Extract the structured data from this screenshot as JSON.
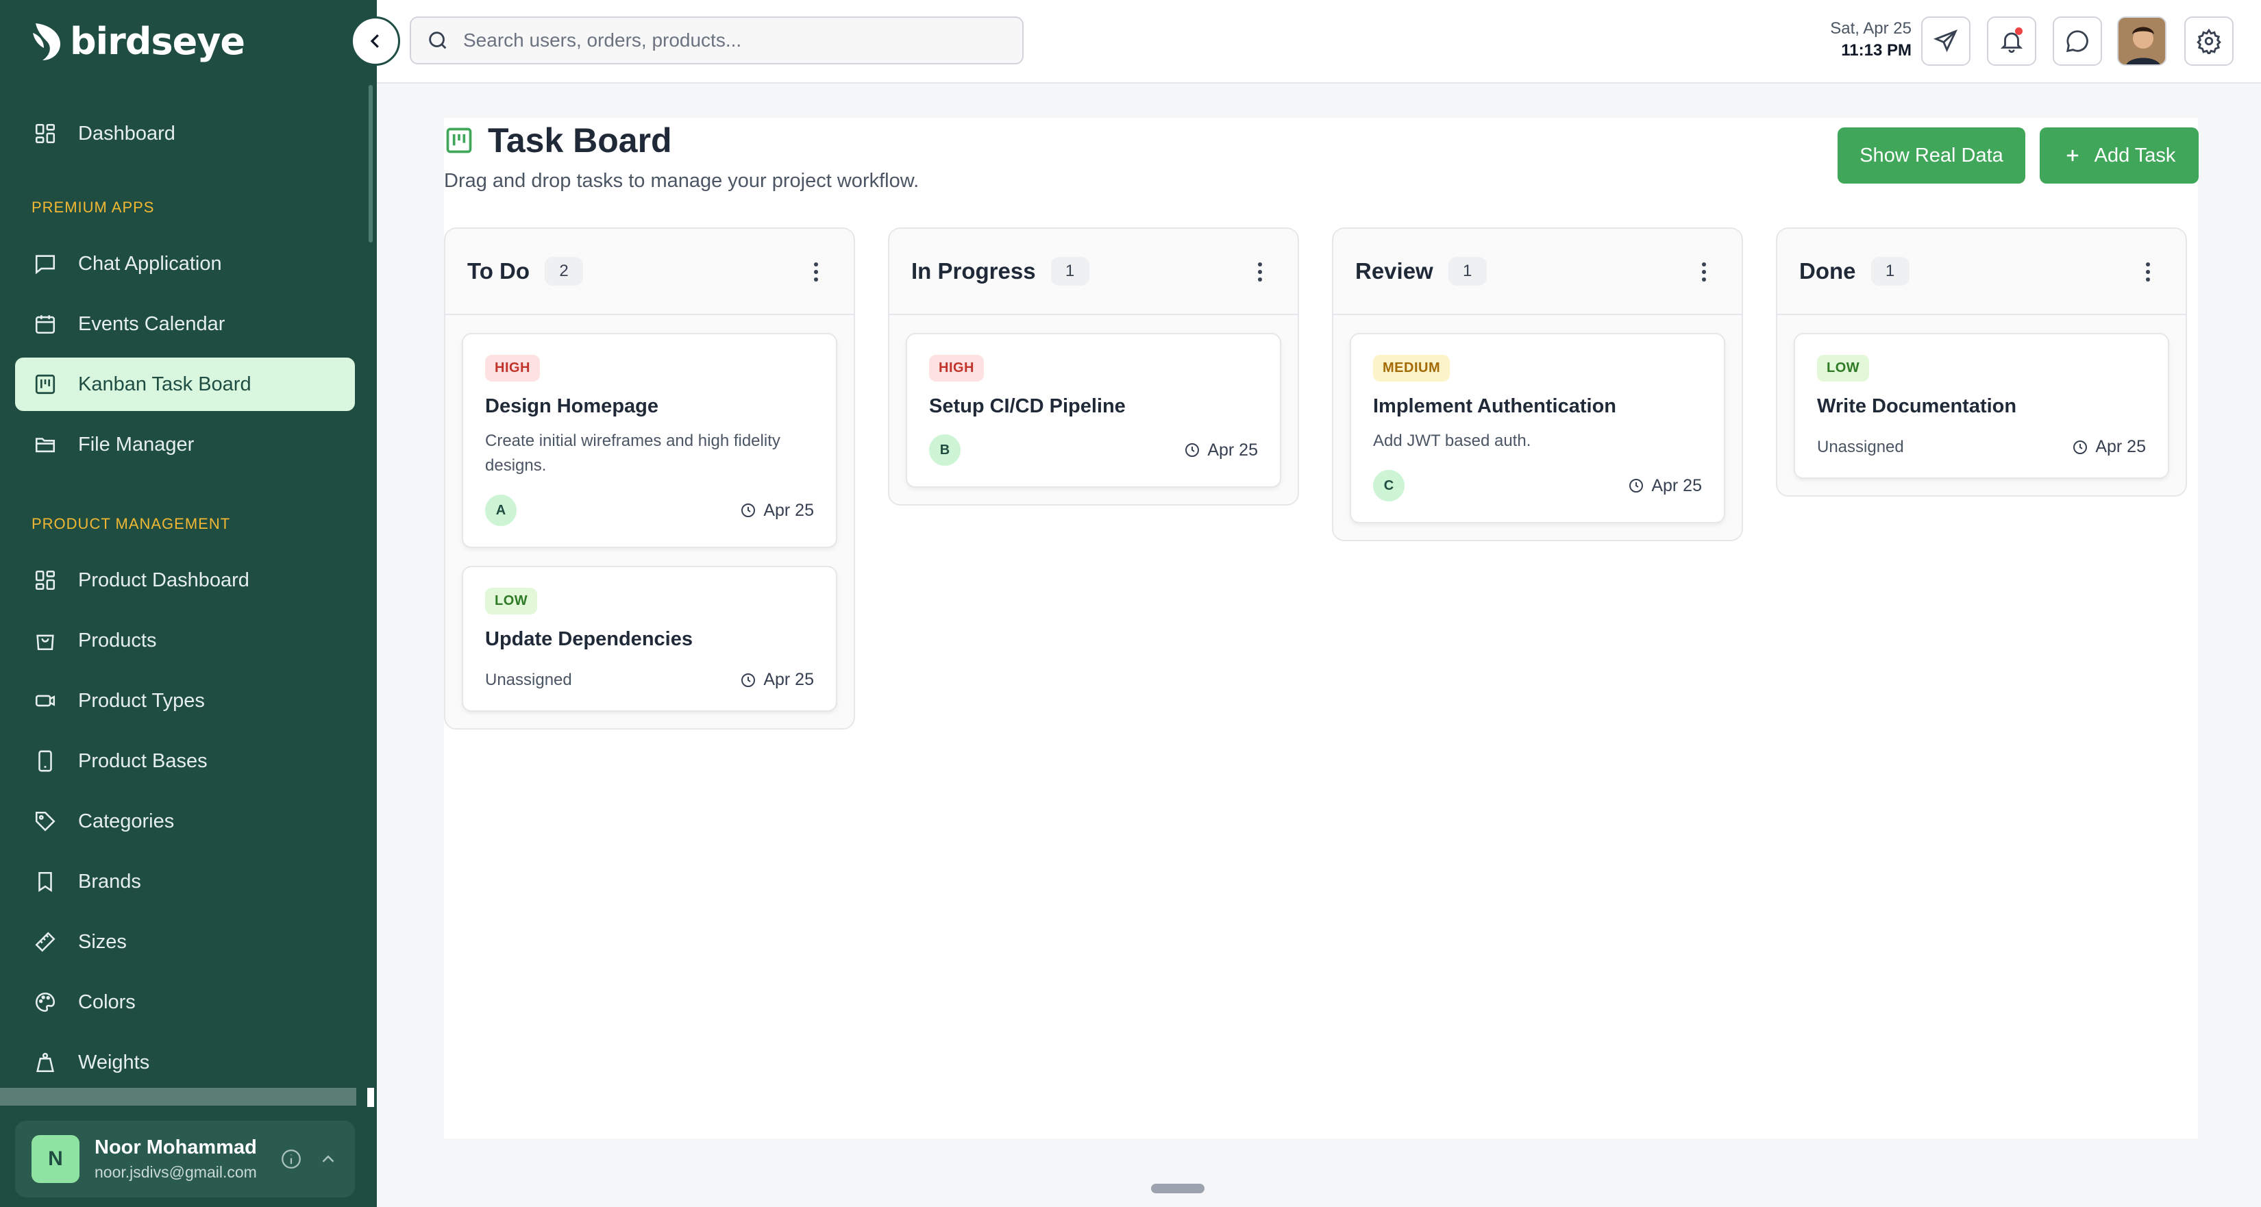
{
  "app": {
    "logo_text": "birdseye"
  },
  "sidebar": {
    "top_items": [
      {
        "label": "Dashboard",
        "icon": "dashboard-grid-icon"
      }
    ],
    "sections": [
      {
        "label": "PREMIUM APPS",
        "items": [
          {
            "label": "Chat Application",
            "icon": "chat-icon"
          },
          {
            "label": "Events Calendar",
            "icon": "calendar-icon"
          },
          {
            "label": "Kanban Task Board",
            "icon": "kanban-icon",
            "active": true
          },
          {
            "label": "File Manager",
            "icon": "folder-icon"
          }
        ]
      },
      {
        "label": "PRODUCT MANAGEMENT",
        "items": [
          {
            "label": "Product Dashboard",
            "icon": "dashboard-grid-icon"
          },
          {
            "label": "Products",
            "icon": "shopping-bag-icon"
          },
          {
            "label": "Product Types",
            "icon": "product-type-icon"
          },
          {
            "label": "Product Bases",
            "icon": "phone-icon"
          },
          {
            "label": "Categories",
            "icon": "tag-icon"
          },
          {
            "label": "Brands",
            "icon": "bookmark-icon"
          },
          {
            "label": "Sizes",
            "icon": "ruler-icon"
          },
          {
            "label": "Colors",
            "icon": "palette-icon"
          },
          {
            "label": "Weights",
            "icon": "weight-icon"
          }
        ]
      }
    ],
    "user": {
      "initial": "N",
      "name": "Noor Mohammad",
      "email": "noor.jsdivs@gmail.com"
    }
  },
  "header": {
    "search_placeholder": "Search users, orders, products...",
    "date": "Sat, Apr 25",
    "time": "11:13 PM",
    "buttons": [
      "send-icon",
      "bell-icon",
      "message-icon",
      "settings-icon"
    ]
  },
  "page": {
    "title": "Task Board",
    "subtitle": "Drag and drop tasks to manage your project workflow.",
    "show_real_data_label": "Show Real Data",
    "add_task_label": "Add Task"
  },
  "columns": [
    {
      "title": "To Do",
      "count": "2",
      "cards": [
        {
          "priority": "HIGH",
          "priority_level": "high",
          "title": "Design Homepage",
          "description": "Create initial wireframes and high fidelity designs.",
          "assignee": "A",
          "due": "Apr 25"
        },
        {
          "priority": "LOW",
          "priority_level": "low",
          "title": "Update Dependencies",
          "description": "",
          "assignee": "",
          "unassigned_text": "Unassigned",
          "due": "Apr 25"
        }
      ]
    },
    {
      "title": "In Progress",
      "count": "1",
      "cards": [
        {
          "priority": "HIGH",
          "priority_level": "high",
          "title": "Setup CI/CD Pipeline",
          "description": "",
          "assignee": "B",
          "due": "Apr 25"
        }
      ]
    },
    {
      "title": "Review",
      "count": "1",
      "cards": [
        {
          "priority": "MEDIUM",
          "priority_level": "medium",
          "title": "Implement Authentication",
          "description": "Add JWT based auth.",
          "assignee": "C",
          "due": "Apr 25"
        }
      ]
    },
    {
      "title": "Done",
      "count": "1",
      "cards": [
        {
          "priority": "LOW",
          "priority_level": "low",
          "title": "Write Documentation",
          "description": "",
          "assignee": "",
          "unassigned_text": "Unassigned",
          "due": "Apr 25"
        }
      ]
    }
  ],
  "colors": {
    "sidebar_bg": "#1f4d42",
    "accent_green": "#3fa65a",
    "section_label": "#f2b833",
    "active_item_bg": "#d9f6de"
  }
}
